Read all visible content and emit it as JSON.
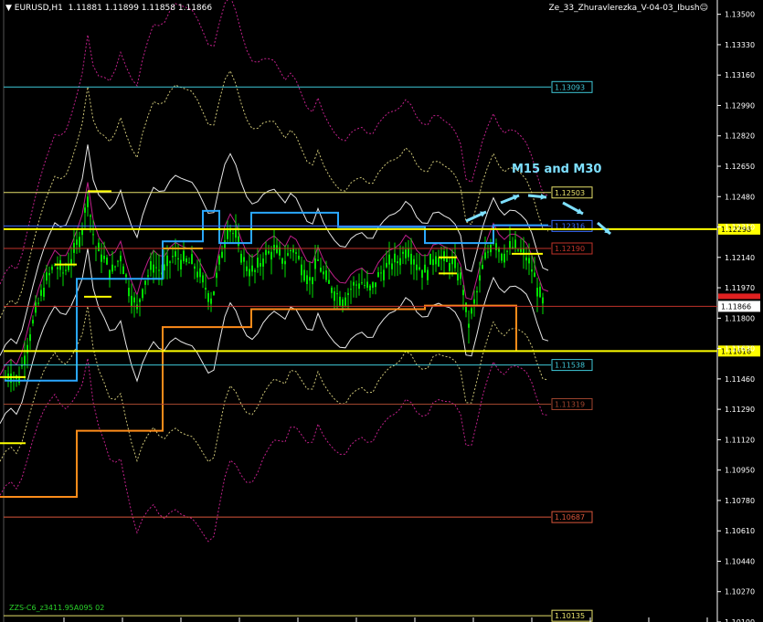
{
  "header": {
    "symbol_tf": "▼ EURUSD,H1",
    "ohlc": "1.11881 1.11899 1.11858 1.11866",
    "indicator": "Ze_33_Zhuravlerezka_V-04-03_Ibush☺"
  },
  "annotation": {
    "text": "M15 and M30",
    "color": "#7ee0ff"
  },
  "footer_label": "ZZS-C6_z3411.95A095 02",
  "chart_data": {
    "type": "line",
    "symbol": "EURUSD",
    "timeframe": "H1",
    "ylim": [
      1.101,
      1.1358
    ],
    "y_ticks": [
      "1.13500",
      "1.13330",
      "1.13160",
      "1.12990",
      "1.12820",
      "1.12650",
      "1.12480",
      "1.12310",
      "1.12140",
      "1.11970",
      "1.11800",
      "1.11630",
      "1.11460",
      "1.11290",
      "1.11120",
      "1.10950",
      "1.10780",
      "1.10610",
      "1.10440",
      "1.10270",
      "1.10100"
    ],
    "current_price": {
      "value": 1.11866,
      "label": "1.11866",
      "color": "#ffffff",
      "text_color": "#000000"
    },
    "levels": [
      {
        "value": 1.13093,
        "label": "1.13093",
        "color": "#3fc8d8"
      },
      {
        "value": 1.12503,
        "label": "1.12503",
        "color": "#e6e06a"
      },
      {
        "value": 1.12316,
        "label": "1.12316",
        "color": "#3a6cff"
      },
      {
        "value": 1.12298,
        "label": "1.12298",
        "color": "#ffff00",
        "tag": true
      },
      {
        "value": 1.1219,
        "label": "1.12190",
        "color": "#c0332a"
      },
      {
        "value": 1.11616,
        "label": "1.11616",
        "color": "#ffff00",
        "tag": true
      },
      {
        "value": 1.11538,
        "label": "1.11538",
        "color": "#3fc8d8"
      },
      {
        "value": 1.11319,
        "label": "1.11319",
        "color": "#a0452e"
      },
      {
        "value": 1.10687,
        "label": "1.10687",
        "color": "#d8553a"
      },
      {
        "value": 1.10135,
        "label": "1.10135",
        "color": "#e6e06a"
      }
    ],
    "colors": {
      "candles": "#00e000",
      "orange_line": "#ff8c1a",
      "blue_line": "#2aa8ff",
      "yellow_steps": "#ffff00",
      "magenta": "#c0208a",
      "white_bands": "#ffffff",
      "yellow_dotted": "#f0e68c",
      "axis_text": "#ffffff"
    },
    "series": [
      {
        "role": "orange_step",
        "points": [
          [
            0,
            1.108
          ],
          [
            84,
            1.108
          ],
          [
            84,
            1.1117
          ],
          [
            178,
            1.1117
          ],
          [
            178,
            1.1175
          ],
          [
            275,
            1.1175
          ],
          [
            275,
            1.1185
          ],
          [
            465,
            1.1185
          ],
          [
            465,
            1.1187
          ],
          [
            565,
            1.1187
          ],
          [
            565,
            1.1162
          ]
        ]
      },
      {
        "role": "blue_step",
        "points": [
          [
            5,
            1.1145
          ],
          [
            84,
            1.1145
          ],
          [
            84,
            1.1202
          ],
          [
            178,
            1.1202
          ],
          [
            178,
            1.1223
          ],
          [
            222,
            1.1223
          ],
          [
            222,
            1.124
          ],
          [
            240,
            1.124
          ],
          [
            240,
            1.1222
          ],
          [
            275,
            1.1222
          ],
          [
            275,
            1.1239
          ],
          [
            370,
            1.1239
          ],
          [
            370,
            1.1231
          ],
          [
            465,
            1.1231
          ],
          [
            465,
            1.1222
          ],
          [
            540,
            1.1222
          ],
          [
            540,
            1.1232
          ],
          [
            600,
            1.1232
          ]
        ]
      },
      {
        "role": "close",
        "points": [
          [
            0,
            1.114
          ],
          [
            10,
            1.115
          ],
          [
            20,
            1.1145
          ],
          [
            30,
            1.1165
          ],
          [
            40,
            1.1185
          ],
          [
            50,
            1.12
          ],
          [
            60,
            1.121
          ],
          [
            70,
            1.1205
          ],
          [
            80,
            1.1215
          ],
          [
            90,
            1.123
          ],
          [
            96,
            1.1248
          ],
          [
            104,
            1.122
          ],
          [
            112,
            1.1215
          ],
          [
            122,
            1.1205
          ],
          [
            132,
            1.1215
          ],
          [
            142,
            1.1195
          ],
          [
            150,
            1.1185
          ],
          [
            158,
            1.12
          ],
          [
            168,
            1.121
          ],
          [
            178,
            1.1205
          ],
          [
            190,
            1.1215
          ],
          [
            200,
            1.1212
          ],
          [
            212,
            1.121
          ],
          [
            222,
            1.12
          ],
          [
            232,
            1.119
          ],
          [
            242,
            1.1215
          ],
          [
            250,
            1.1232
          ],
          [
            258,
            1.1225
          ],
          [
            268,
            1.121
          ],
          [
            278,
            1.1205
          ],
          [
            290,
            1.1215
          ],
          [
            300,
            1.1218
          ],
          [
            312,
            1.1212
          ],
          [
            320,
            1.122
          ],
          [
            330,
            1.121
          ],
          [
            340,
            1.12
          ],
          [
            348,
            1.1212
          ],
          [
            356,
            1.1202
          ],
          [
            366,
            1.1195
          ],
          [
            376,
            1.119
          ],
          [
            386,
            1.1198
          ],
          [
            396,
            1.12
          ],
          [
            406,
            1.1195
          ],
          [
            416,
            1.1205
          ],
          [
            426,
            1.121
          ],
          [
            436,
            1.1212
          ],
          [
            446,
            1.122
          ],
          [
            456,
            1.121
          ],
          [
            466,
            1.1205
          ],
          [
            476,
            1.1215
          ],
          [
            486,
            1.1212
          ],
          [
            496,
            1.121
          ],
          [
            506,
            1.12
          ],
          [
            512,
            1.1175
          ],
          [
            520,
            1.119
          ],
          [
            530,
            1.1212
          ],
          [
            540,
            1.1225
          ],
          [
            550,
            1.1215
          ],
          [
            560,
            1.122
          ],
          [
            568,
            1.1218
          ],
          [
            576,
            1.1214
          ],
          [
            584,
            1.1205
          ],
          [
            590,
            1.1193
          ],
          [
            595,
            1.1187
          ]
        ]
      }
    ],
    "arrows": 5
  }
}
